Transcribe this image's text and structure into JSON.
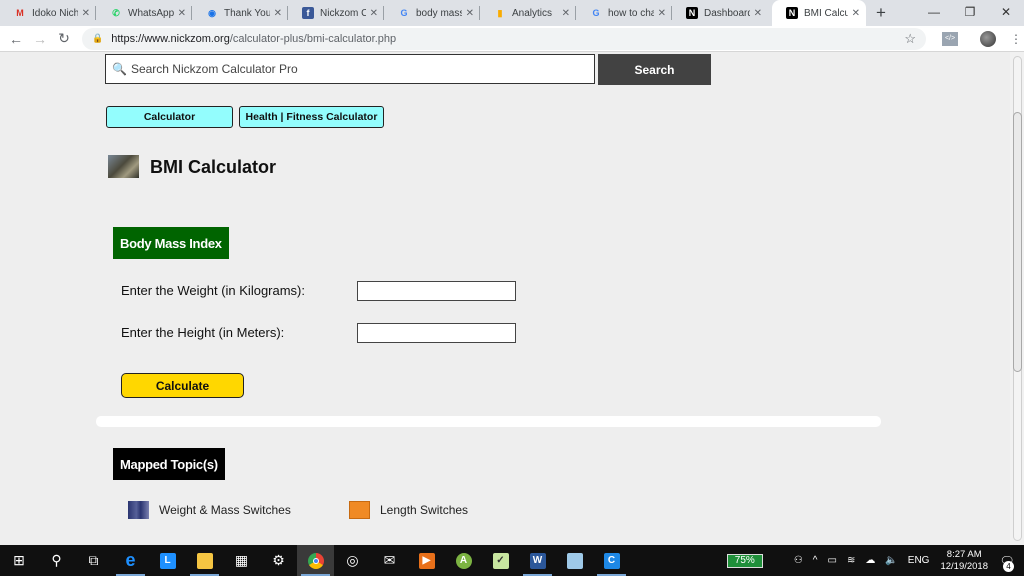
{
  "browser": {
    "tabs": [
      {
        "title": "Idoko Nicho",
        "icon": "gmail-icon",
        "glyph": "M",
        "color": "#d93025"
      },
      {
        "title": "WhatsApp",
        "icon": "whatsapp-icon",
        "glyph": "✆",
        "color": "#25d366"
      },
      {
        "title": "Thank You f",
        "icon": "shield-icon",
        "glyph": "◉",
        "color": "#1a73e8"
      },
      {
        "title": "Nickzom Ca",
        "icon": "facebook-icon",
        "glyph": "f",
        "color": "#3b5998"
      },
      {
        "title": "body mass",
        "icon": "google-icon",
        "glyph": "G",
        "color": "#4285f4"
      },
      {
        "title": "Analytics",
        "icon": "analytics-icon",
        "glyph": "▮",
        "color": "#f9ab00"
      },
      {
        "title": "how to cha",
        "icon": "google-icon",
        "glyph": "G",
        "color": "#4285f4"
      },
      {
        "title": "Dashboard",
        "icon": "nickzom-icon",
        "glyph": "N",
        "color": "#000000"
      },
      {
        "title": "BMI Calcula",
        "icon": "nickzom-icon",
        "glyph": "N",
        "color": "#000000",
        "active": true
      }
    ],
    "new_tab": "+",
    "window_controls": {
      "minimize": "—",
      "restore": "❐",
      "close": "✕"
    },
    "url_host": "https://www.nickzom.org",
    "url_path": "/calculator-plus/bmi-calculator.php",
    "ext_label": "</>"
  },
  "page": {
    "search_placeholder": "Search Nickzom Calculator Pro",
    "search_button": "Search",
    "breadcrumbs": [
      "Calculator",
      "Health | Fitness Calculator"
    ],
    "title": "BMI Calculator",
    "section_header": "Body Mass Index",
    "fields": {
      "weight_label": "Enter the Weight (in Kilograms):",
      "weight_value": "",
      "height_label": "Enter the Height (in Meters):",
      "height_value": ""
    },
    "calculate_button": "Calculate",
    "mapped_header": "Mapped Topic(s)",
    "topics": [
      "Weight & Mass Switches",
      "Length Switches"
    ]
  },
  "taskbar": {
    "battery": "75%",
    "language": "ENG",
    "time": "8:27 AM",
    "date": "12/19/2018",
    "notifications": "4"
  }
}
